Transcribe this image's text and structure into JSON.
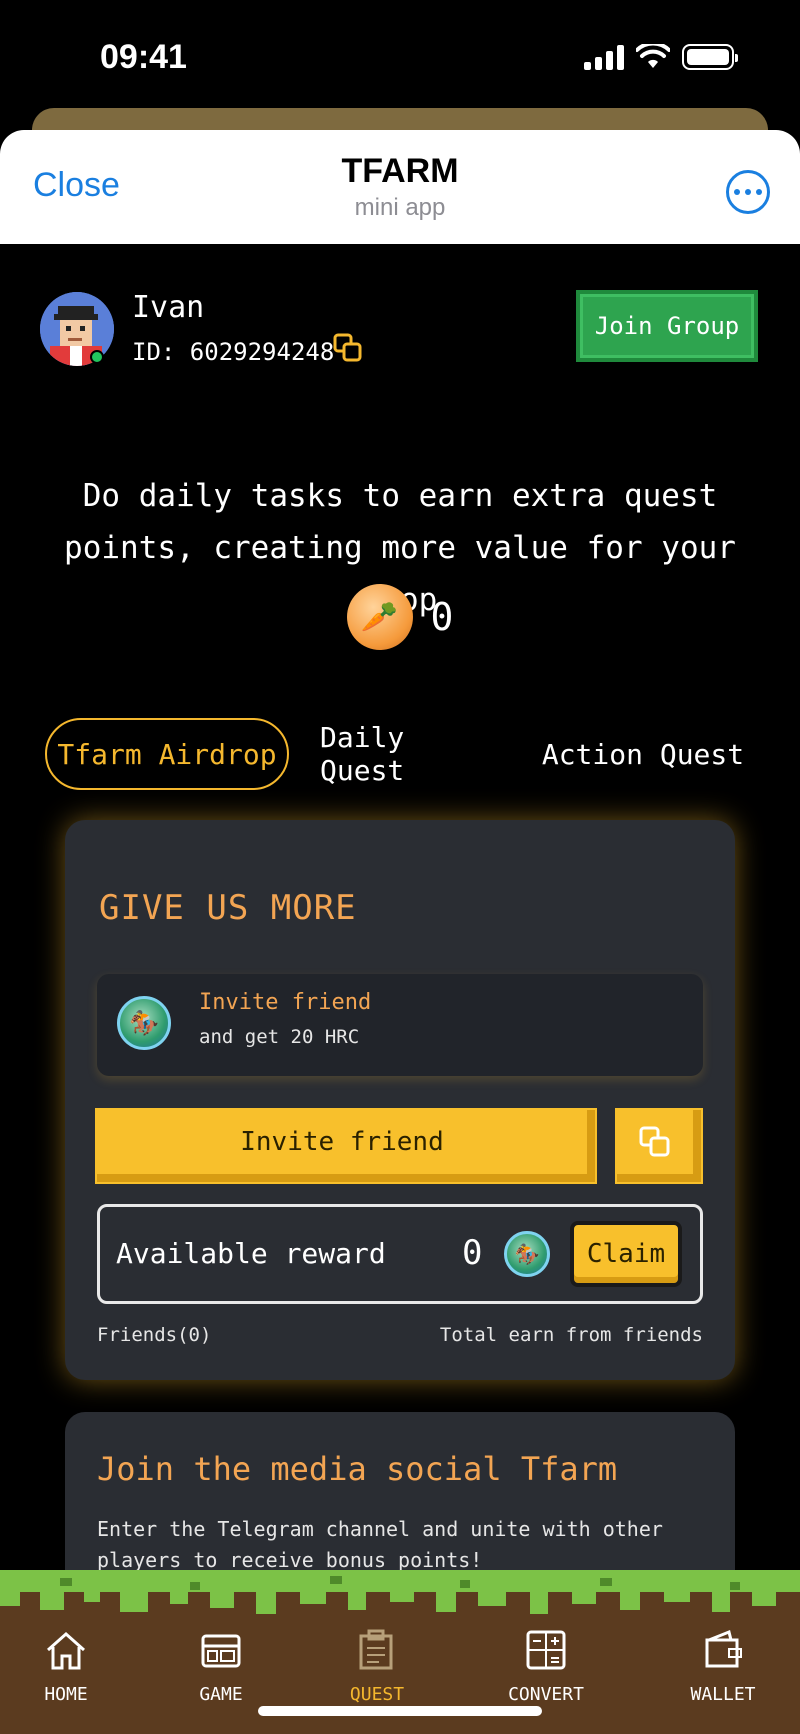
{
  "status_bar": {
    "time": "09:41"
  },
  "telegram_header": {
    "close_label": "Close",
    "title": "TFARM",
    "subtitle": "mini app"
  },
  "user": {
    "name": "Ivan",
    "id_label": "ID: 6029294248",
    "join_group_label": "Join Group"
  },
  "intro": {
    "text": "Do daily tasks to earn extra quest points, creating more value for your crop",
    "points": "0"
  },
  "tabs": [
    {
      "label": "Tfarm Airdrop",
      "active": true
    },
    {
      "label": "Daily Quest",
      "active": false
    },
    {
      "label": "Action Quest",
      "active": false
    }
  ],
  "give_us_more": {
    "title": "GIVE US MORE",
    "invite_title": "Invite friend",
    "invite_subtitle": "and get 20 HRC",
    "invite_button": "Invite friend",
    "available_reward_label": "Available reward",
    "available_reward_value": "0",
    "claim_label": "Claim",
    "friends_label": "Friends(0)",
    "total_earn_label": "Total earn from friends"
  },
  "social_card": {
    "title": "Join the media social Tfarm",
    "description": "Enter the Telegram channel and unite with other players to receive bonus points!"
  },
  "bottom_nav": [
    {
      "label": "HOME",
      "icon": "home-icon",
      "active": false
    },
    {
      "label": "GAME",
      "icon": "game-icon",
      "active": false
    },
    {
      "label": "QUEST",
      "icon": "quest-icon",
      "active": true
    },
    {
      "label": "CONVERT",
      "icon": "convert-icon",
      "active": false
    },
    {
      "label": "WALLET",
      "icon": "wallet-icon",
      "active": false
    }
  ],
  "colors": {
    "accent_gold": "#f5b82e",
    "accent_orange": "#f3a553",
    "join_green": "#2ea44f",
    "telegram_blue": "#1a7fe0",
    "nav_brown": "#5b3b1f",
    "grass_green": "#7cc247"
  }
}
